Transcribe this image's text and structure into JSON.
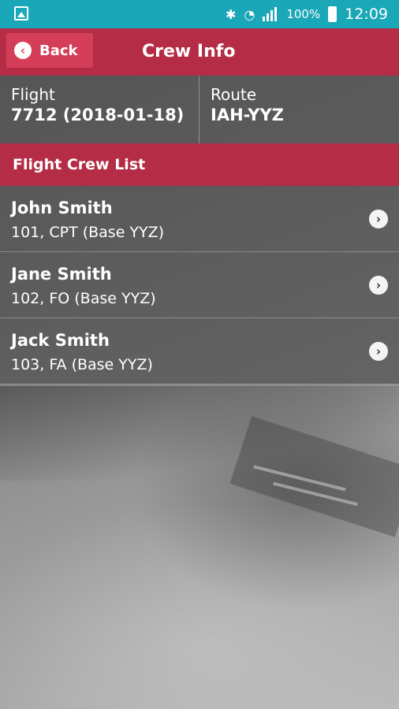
{
  "status_bar": {
    "battery_percent": "100%",
    "time": "12:09",
    "icons": [
      "image-icon",
      "bluetooth-icon",
      "wifi-icon",
      "signal-icon",
      "battery-icon"
    ]
  },
  "header": {
    "back_label": "Back",
    "title": "Crew Info"
  },
  "flight_info": {
    "flight_label": "Flight",
    "flight_value": "7712 (2018-01-18)",
    "route_label": "Route",
    "route_value": "IAH-YYZ"
  },
  "crew_section_title": "Flight Crew List",
  "crew": [
    {
      "name": "John Smith",
      "detail": "101, CPT (Base YYZ)"
    },
    {
      "name": "Jane Smith",
      "detail": "102, FO (Base YYZ)"
    },
    {
      "name": "Jack Smith",
      "detail": "103, FA (Base YYZ)"
    }
  ],
  "colors": {
    "status_bar": "#1aa7b8",
    "brand_red": "#b42c45",
    "back_button": "#d43e59"
  }
}
